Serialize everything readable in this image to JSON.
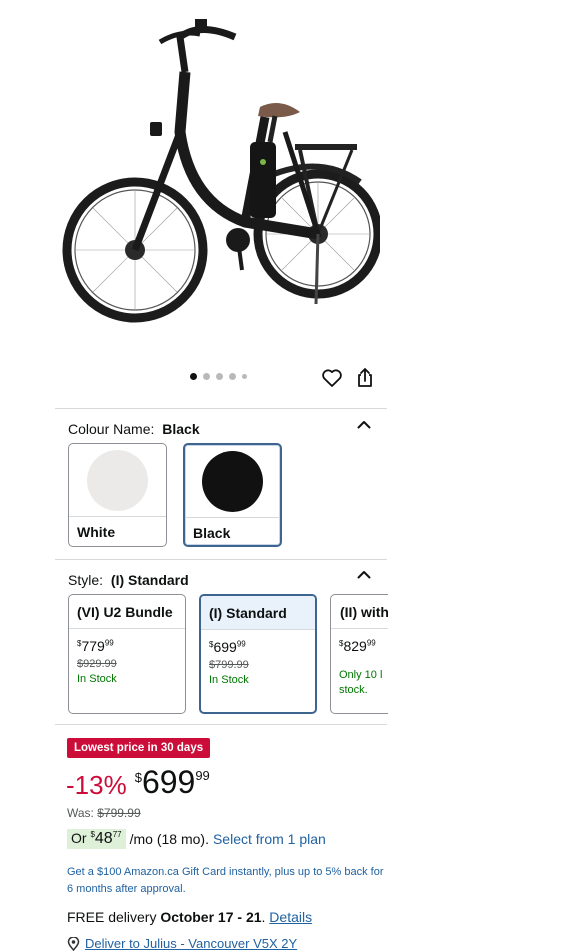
{
  "product": {
    "image_alt": "Black step-through electric bike",
    "carousel_dot_count": 5,
    "carousel_active_index": 0
  },
  "colour": {
    "label": "Colour Name:",
    "selected": "Black",
    "options": [
      {
        "name": "White",
        "swatch": "#ebeae8",
        "selected": false
      },
      {
        "name": "Black",
        "swatch": "#111111",
        "selected": true
      }
    ]
  },
  "style": {
    "label": "Style:",
    "selected": "(I) Standard",
    "options": [
      {
        "name": "(VI) U2 Bundle",
        "dollar": "$",
        "whole": "779",
        "fraction": "99",
        "was": "$929.99",
        "stock": "In Stock",
        "selected": false
      },
      {
        "name": "(I) Standard",
        "dollar": "$",
        "whole": "699",
        "fraction": "99",
        "was": "$799.99",
        "stock": "In Stock",
        "selected": true
      },
      {
        "name": "(II) with",
        "dollar": "$",
        "whole": "829",
        "fraction": "99",
        "was": "",
        "stock": "Only 10 l stock.",
        "selected": false
      }
    ]
  },
  "deal": {
    "badge": "Lowest price in 30 days",
    "discount": "-13%",
    "dollar": "$",
    "whole": "699",
    "fraction": "99",
    "was_label": "Was:",
    "was_price": "$799.99"
  },
  "installment": {
    "prefix": "Or",
    "dollar": "$",
    "whole": "48",
    "fraction": "77",
    "suffix": "/mo (18 mo).",
    "link": "Select from 1 plan"
  },
  "promo": "Get a $100 Amazon.ca Gift Card instantly, plus up to 5% back for 6 months after approval.",
  "delivery": {
    "prefix": "FREE delivery",
    "dates": "October 17 - 21",
    "sep": ".",
    "link": "Details"
  },
  "deliver_to": "Deliver to Julius - Vancouver V5X 2Y",
  "colors": {
    "accent_blue": "#3e6490",
    "deal_red": "#cc0c39",
    "stock_green": "#007600",
    "link_blue": "#2162a1"
  }
}
